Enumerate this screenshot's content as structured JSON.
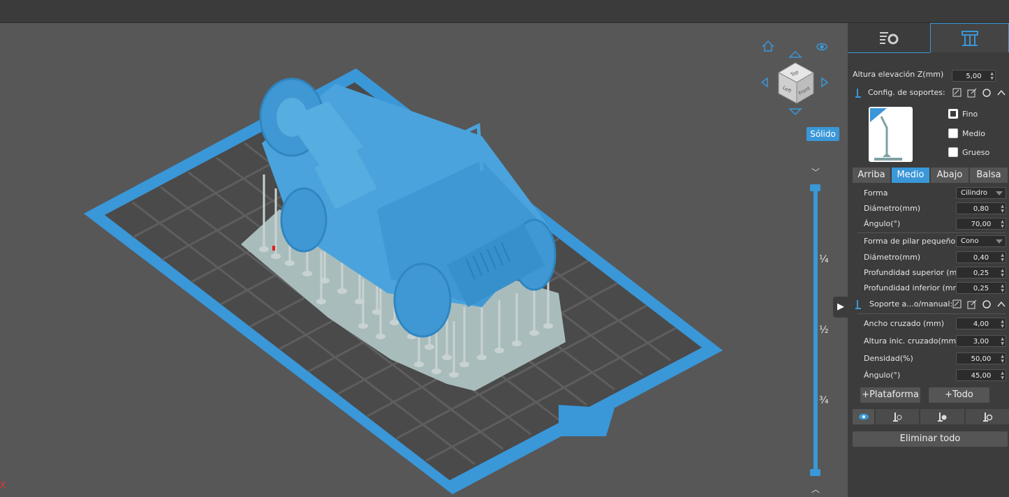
{
  "viewport": {
    "view_mode_button": "Sólido",
    "layer_ticks": [
      "¼",
      "½",
      "¾"
    ],
    "axis_label": "X",
    "navcube_faces": [
      "Top",
      "Left",
      "Front"
    ]
  },
  "panel": {
    "tabs": [
      {
        "name": "settings-tab",
        "icon": "list-gear-icon"
      },
      {
        "name": "supports-tab",
        "icon": "support-pillars-icon"
      }
    ],
    "lift_height_label": "Altura elevación Z(mm)",
    "lift_height_value": "5,00",
    "support_config_label": "Config. de soportes:",
    "density_options": [
      {
        "label": "Fino",
        "checked": true
      },
      {
        "label": "Medio",
        "checked": false
      },
      {
        "label": "Grueso",
        "checked": false
      }
    ],
    "subtabs": [
      "Arriba",
      "Medio",
      "Abajo",
      "Balsa"
    ],
    "active_subtab": "Medio",
    "shape_label": "Forma",
    "shape_value": "Cilindro",
    "diameter_label": "Diámetro(mm)",
    "diameter_value": "0,80",
    "angle_label": "Ángulo(°)",
    "angle_value": "70,00",
    "small_pillar_label": "Forma de pilar pequeño",
    "small_pillar_value": "Cono",
    "small_diameter_label": "Diámetro(mm)",
    "small_diameter_value": "0,40",
    "top_depth_label": "Profundidad superior (mm)",
    "top_depth_value": "0,25",
    "bottom_depth_label": "Profundidad inferior (mm)",
    "bottom_depth_value": "0,25",
    "auto_manual_label": "Soporte a...o/manual:",
    "cross_width_label": "Ancho cruzado (mm)",
    "cross_width_value": "4,00",
    "cross_height_label": "Altura inic. cruzado(mm)",
    "cross_height_value": "3,00",
    "density_label": "Densidad(%)",
    "density_value": "50,00",
    "angle2_label": "Ángulo(°)",
    "angle2_value": "45,00",
    "platform_button": "+Plataforma",
    "all_button": "+Todo",
    "delete_all_button": "Eliminar todo"
  },
  "colors": {
    "accent": "#3a97d8",
    "model": "#4aa3dc",
    "supports": "#b8c6c6",
    "panel_bg": "#3c3c3c",
    "viewport_bg": "#575757"
  }
}
